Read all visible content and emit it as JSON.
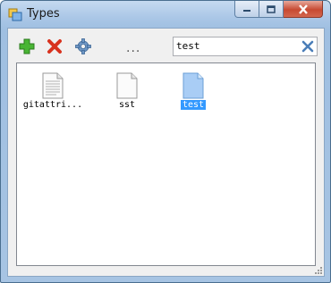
{
  "window": {
    "title": "Types",
    "minimize_icon": "minimize-icon",
    "maximize_icon": "maximize-icon",
    "close_icon": "close-icon"
  },
  "toolbar": {
    "add_icon": "plus-icon",
    "delete_icon": "red-x-icon",
    "settings_icon": "gear-icon",
    "more_label": "..."
  },
  "search": {
    "value": "test"
  },
  "items": [
    {
      "label": "gitattri...",
      "icon": "text-file-icon",
      "selected": false
    },
    {
      "label": "sst",
      "icon": "blank-file-icon",
      "selected": false
    },
    {
      "label": "test",
      "icon": "blue-file-icon",
      "selected": true
    }
  ],
  "colors": {
    "selection": "#3399ff",
    "add_green": "#3aa82a",
    "delete_red": "#d8321e"
  }
}
